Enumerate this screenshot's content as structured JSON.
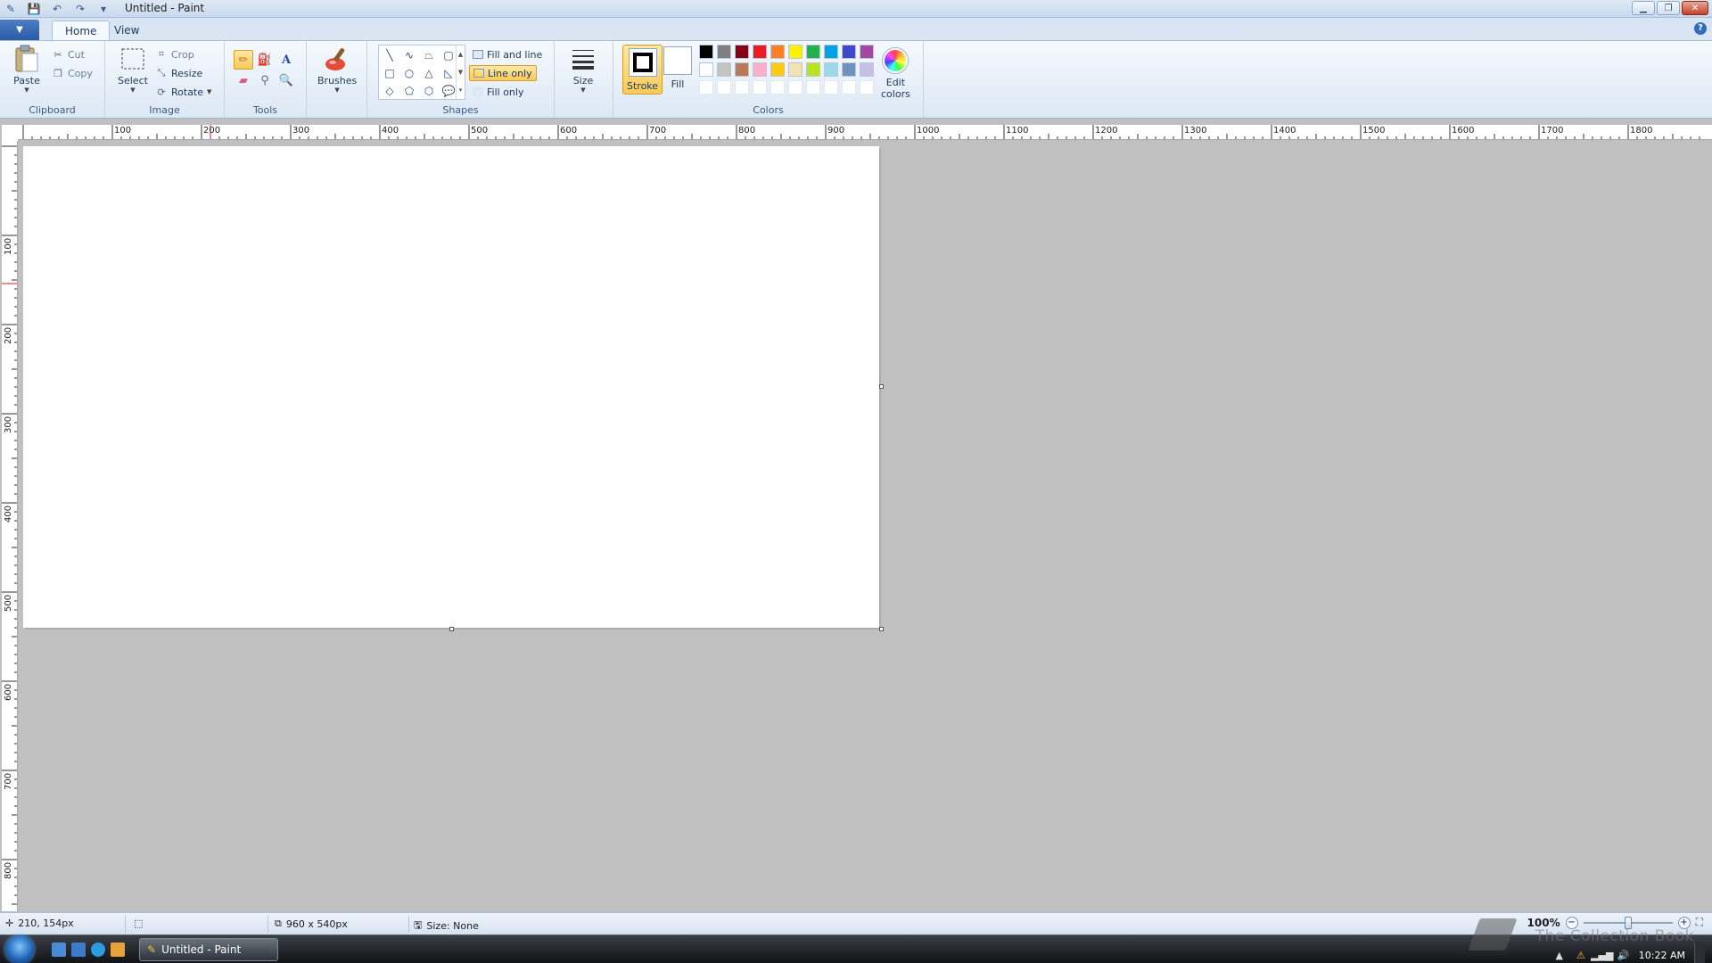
{
  "window": {
    "title": "Untitled - Paint"
  },
  "tabs": [
    {
      "label": "Home",
      "active": true
    },
    {
      "label": "View",
      "active": false
    }
  ],
  "clipboard": {
    "group_label": "Clipboard",
    "paste": "Paste",
    "cut": "Cut",
    "copy": "Copy"
  },
  "image": {
    "group_label": "Image",
    "select": "Select",
    "crop": "Crop",
    "resize": "Resize",
    "rotate": "Rotate"
  },
  "tools": {
    "group_label": "Tools"
  },
  "brushes": {
    "label": "Brushes"
  },
  "shapes": {
    "group_label": "Shapes",
    "fill_and_line": "Fill and line",
    "line_only": "Line only",
    "fill_only": "Fill only"
  },
  "size": {
    "label": "Size"
  },
  "colors": {
    "group_label": "Colors",
    "stroke": "Stroke",
    "fill": "Fill",
    "edit_colors_line1": "Edit",
    "edit_colors_line2": "colors",
    "stroke_color": "#000000",
    "fill_color": "#ffffff",
    "palette_row1": [
      "#000000",
      "#7f7f7f",
      "#880015",
      "#ed1c24",
      "#ff7f27",
      "#fff200",
      "#22b14c",
      "#00a2e8",
      "#3f48cc",
      "#a349a4"
    ],
    "palette_row2": [
      "#ffffff",
      "#c3c3c3",
      "#b97a57",
      "#ffaec9",
      "#ffc90e",
      "#efe4b0",
      "#b5e61d",
      "#99d9ea",
      "#7092be",
      "#c8bfe7"
    ]
  },
  "ruler": {
    "h_labels": [
      "100",
      "200",
      "300",
      "400",
      "500",
      "600",
      "700",
      "800",
      "900",
      "1000",
      "1100",
      "1200",
      "1300",
      "1400",
      "1500",
      "1600",
      "1700",
      "1800"
    ],
    "v_labels": [
      "100",
      "200",
      "300",
      "400",
      "500",
      "600",
      "700",
      "800"
    ]
  },
  "status": {
    "cursor_position": "210, 154px",
    "canvas_size": "960 x 540px",
    "selection_size": "Size: None",
    "zoom": "100%"
  },
  "taskbar": {
    "task_label": "Untitled - Paint",
    "clock": "10:22 AM"
  },
  "watermark": "The Collection Book"
}
